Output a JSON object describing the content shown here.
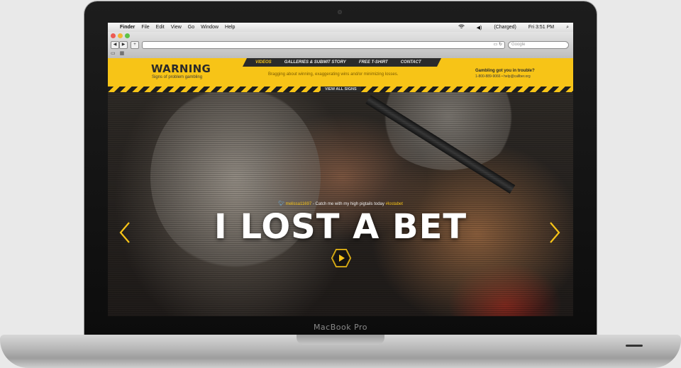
{
  "device": {
    "label": "MacBook Pro"
  },
  "menubar": {
    "app": "Finder",
    "items": [
      "File",
      "Edit",
      "View",
      "Go",
      "Window",
      "Help"
    ],
    "battery": "(Charged)",
    "clock": "Fri 3:51 PM"
  },
  "browser": {
    "search_placeholder": "Google"
  },
  "site": {
    "logo_title": "WARNING",
    "logo_subtitle": "Signs of problem gambling",
    "nav": [
      "VIDEOS",
      "GALLERIES & SUBMIT STORY",
      "FREE T-SHIRT",
      "CONTACT"
    ],
    "tagline": "Bragging about winning, exaggerating wins and/or minimizing losses.",
    "help_question": "Gambling got you in trouble?",
    "help_contact": "1-800-889-9066 • help@callber.org",
    "view_all": "VIEW ALL SIGNS"
  },
  "hero": {
    "tweet_handle": "melissa11697",
    "tweet_text": " - Catch me with my high pigtails today ",
    "tweet_tag": "#lostabet",
    "headline": "I LOST A BET"
  },
  "colors": {
    "accent": "#f7c417",
    "dark": "#2b2b2b"
  }
}
